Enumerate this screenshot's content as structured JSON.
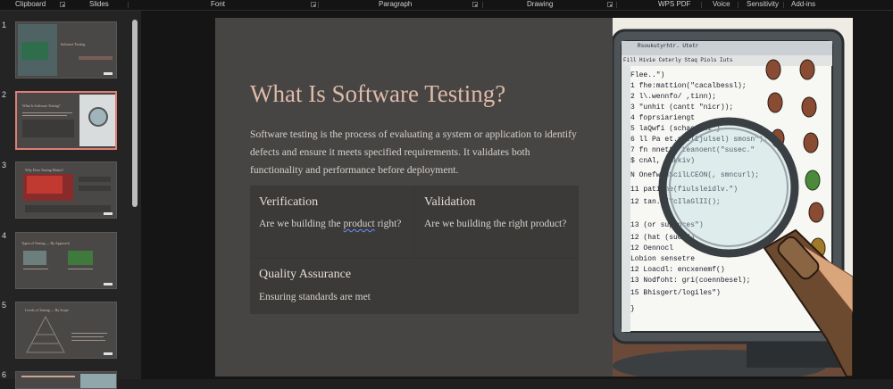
{
  "ribbon": {
    "groups": [
      "Clipboard",
      "Slides",
      "Font",
      "Paragraph",
      "Drawing",
      "WPS PDF",
      "Voice",
      "Sensitivity",
      "Add-ins"
    ]
  },
  "thumbnails": [
    {
      "num": "1",
      "title": "Software Testing",
      "active": false
    },
    {
      "num": "2",
      "title": "What Is Software Testing?",
      "active": true
    },
    {
      "num": "3",
      "title": "Why Does Testing Matter?",
      "active": false
    },
    {
      "num": "4",
      "title": "Types of Testing — By Approach",
      "active": false
    },
    {
      "num": "5",
      "title": "Levels of Testing — By Scope",
      "active": false
    },
    {
      "num": "6",
      "title": "",
      "active": false
    }
  ],
  "slide": {
    "title": "What Is Software Testing?",
    "body": "Software testing is the process of evaluating a system or application to identify defects and ensure it meets specified requirements. It validates both functionality and performance before deployment.",
    "cells": [
      {
        "heading": "Verification",
        "text_a": "Are we building the ",
        "text_b": "product",
        "text_c": " right?"
      },
      {
        "heading": "Validation",
        "text": "Are we building the right product?"
      },
      {
        "heading": "Quality Assurance",
        "text": "Ensuring standards are met"
      }
    ]
  },
  "illustration": {
    "window_title": "Rsoukutyrhtr. Utetr",
    "menu": "Fill  Hivie  Ceterly  Staq  Piols  Iuts",
    "code_lines": [
      "Flee..\")",
      "1  fhe:mattion(\"cacalbessl);",
      "2  l\\.wennfo/ ,tinn);",
      "3  \"unhit (cantt \"nicr));",
      "4  foprsiariengt",
      "5  laQwfi  (schaetcaI\"}",
      "6  ll Pa   et.sntI2julsel) smosn\");",
      "7  fn  nnett, teanoent(\"susec.\"",
      "   $  cnAl, (mkkiv)",
      "   N   OnefwonScilLCEON(, smncurl);",
      "11 patizne(fiulsleidlv.\")",
      "12 tan.o\"YcIlaGlII();",
      "13 (or  supences\")",
      "12 (hat   (suce\")",
      "12 Oennocl",
      "   Lobion sensetre",
      "12 Loacdl:  encxenemf()",
      "13 Nodfoht:   gri(coennbesel);",
      "15 Bhisgert/logiles\")",
      "}"
    ]
  },
  "colors": {
    "slide_bg": "#474544",
    "title": "#ddbba8",
    "accent_active_thumb": "#e07d74"
  }
}
